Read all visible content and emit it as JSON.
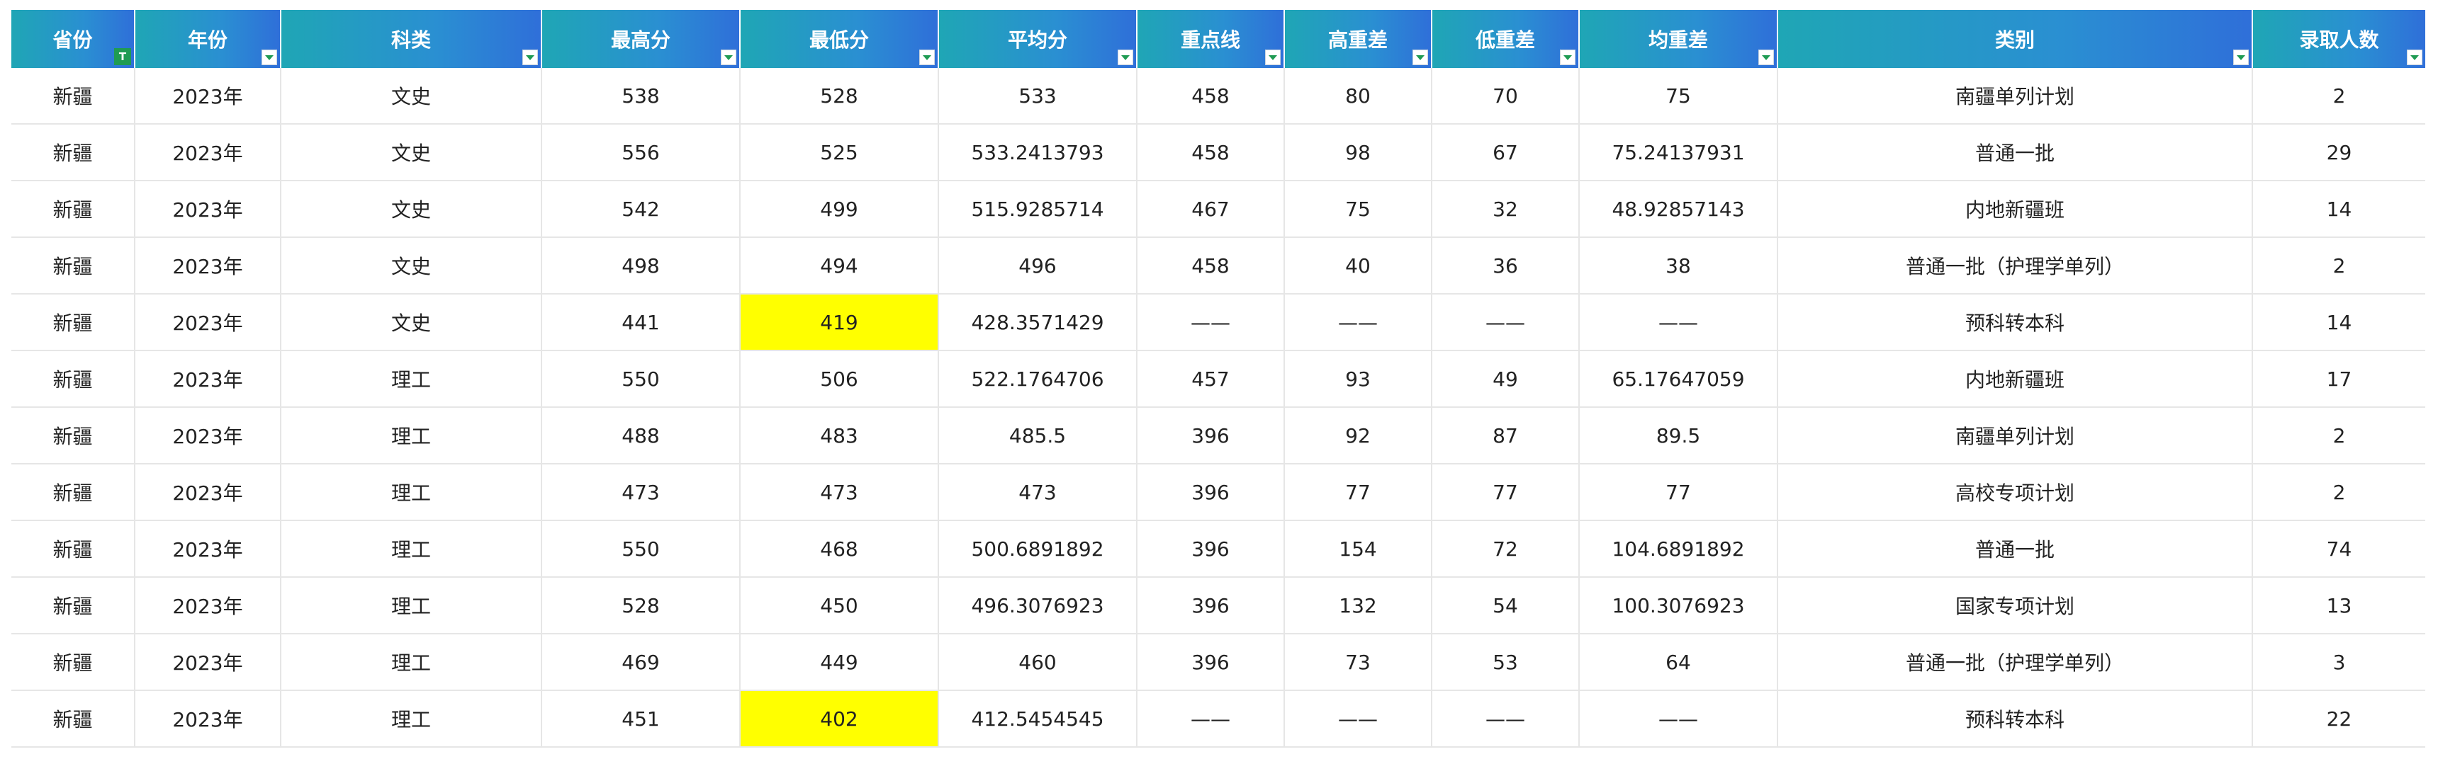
{
  "table": {
    "headers": [
      "省份",
      "年份",
      "科类",
      "最高分",
      "最低分",
      "平均分",
      "重点线",
      "高重差",
      "低重差",
      "均重差",
      "类别",
      "录取人数"
    ],
    "filter_active_label": "T",
    "rows": [
      [
        "新疆",
        "2023年",
        "文史",
        "538",
        "528",
        "533",
        "458",
        "80",
        "70",
        "75",
        "南疆单列计划",
        "2"
      ],
      [
        "新疆",
        "2023年",
        "文史",
        "556",
        "525",
        "533.2413793",
        "458",
        "98",
        "67",
        "75.24137931",
        "普通一批",
        "29"
      ],
      [
        "新疆",
        "2023年",
        "文史",
        "542",
        "499",
        "515.9285714",
        "467",
        "75",
        "32",
        "48.92857143",
        "内地新疆班",
        "14"
      ],
      [
        "新疆",
        "2023年",
        "文史",
        "498",
        "494",
        "496",
        "458",
        "40",
        "36",
        "38",
        "普通一批（护理学单列）",
        "2"
      ],
      [
        "新疆",
        "2023年",
        "文史",
        "441",
        "419",
        "428.3571429",
        "——",
        "——",
        "——",
        "——",
        "预科转本科",
        "14"
      ],
      [
        "新疆",
        "2023年",
        "理工",
        "550",
        "506",
        "522.1764706",
        "457",
        "93",
        "49",
        "65.17647059",
        "内地新疆班",
        "17"
      ],
      [
        "新疆",
        "2023年",
        "理工",
        "488",
        "483",
        "485.5",
        "396",
        "92",
        "87",
        "89.5",
        "南疆单列计划",
        "2"
      ],
      [
        "新疆",
        "2023年",
        "理工",
        "473",
        "473",
        "473",
        "396",
        "77",
        "77",
        "77",
        "高校专项计划",
        "2"
      ],
      [
        "新疆",
        "2023年",
        "理工",
        "550",
        "468",
        "500.6891892",
        "396",
        "154",
        "72",
        "104.6891892",
        "普通一批",
        "74"
      ],
      [
        "新疆",
        "2023年",
        "理工",
        "528",
        "450",
        "496.3076923",
        "396",
        "132",
        "54",
        "100.3076923",
        "国家专项计划",
        "13"
      ],
      [
        "新疆",
        "2023年",
        "理工",
        "469",
        "449",
        "460",
        "396",
        "73",
        "53",
        "64",
        "普通一批（护理学单列）",
        "3"
      ],
      [
        "新疆",
        "2023年",
        "理工",
        "451",
        "402",
        "412.5454545",
        "——",
        "——",
        "——",
        "——",
        "预科转本科",
        "22"
      ]
    ],
    "highlight_color": "#ffff00",
    "highlighted_cells": [
      [
        4,
        4
      ],
      [
        11,
        4
      ]
    ],
    "header_gradient": [
      "#1fa6b5",
      "#2f6fd9"
    ],
    "filter_icon": "chevron-down-icon"
  }
}
